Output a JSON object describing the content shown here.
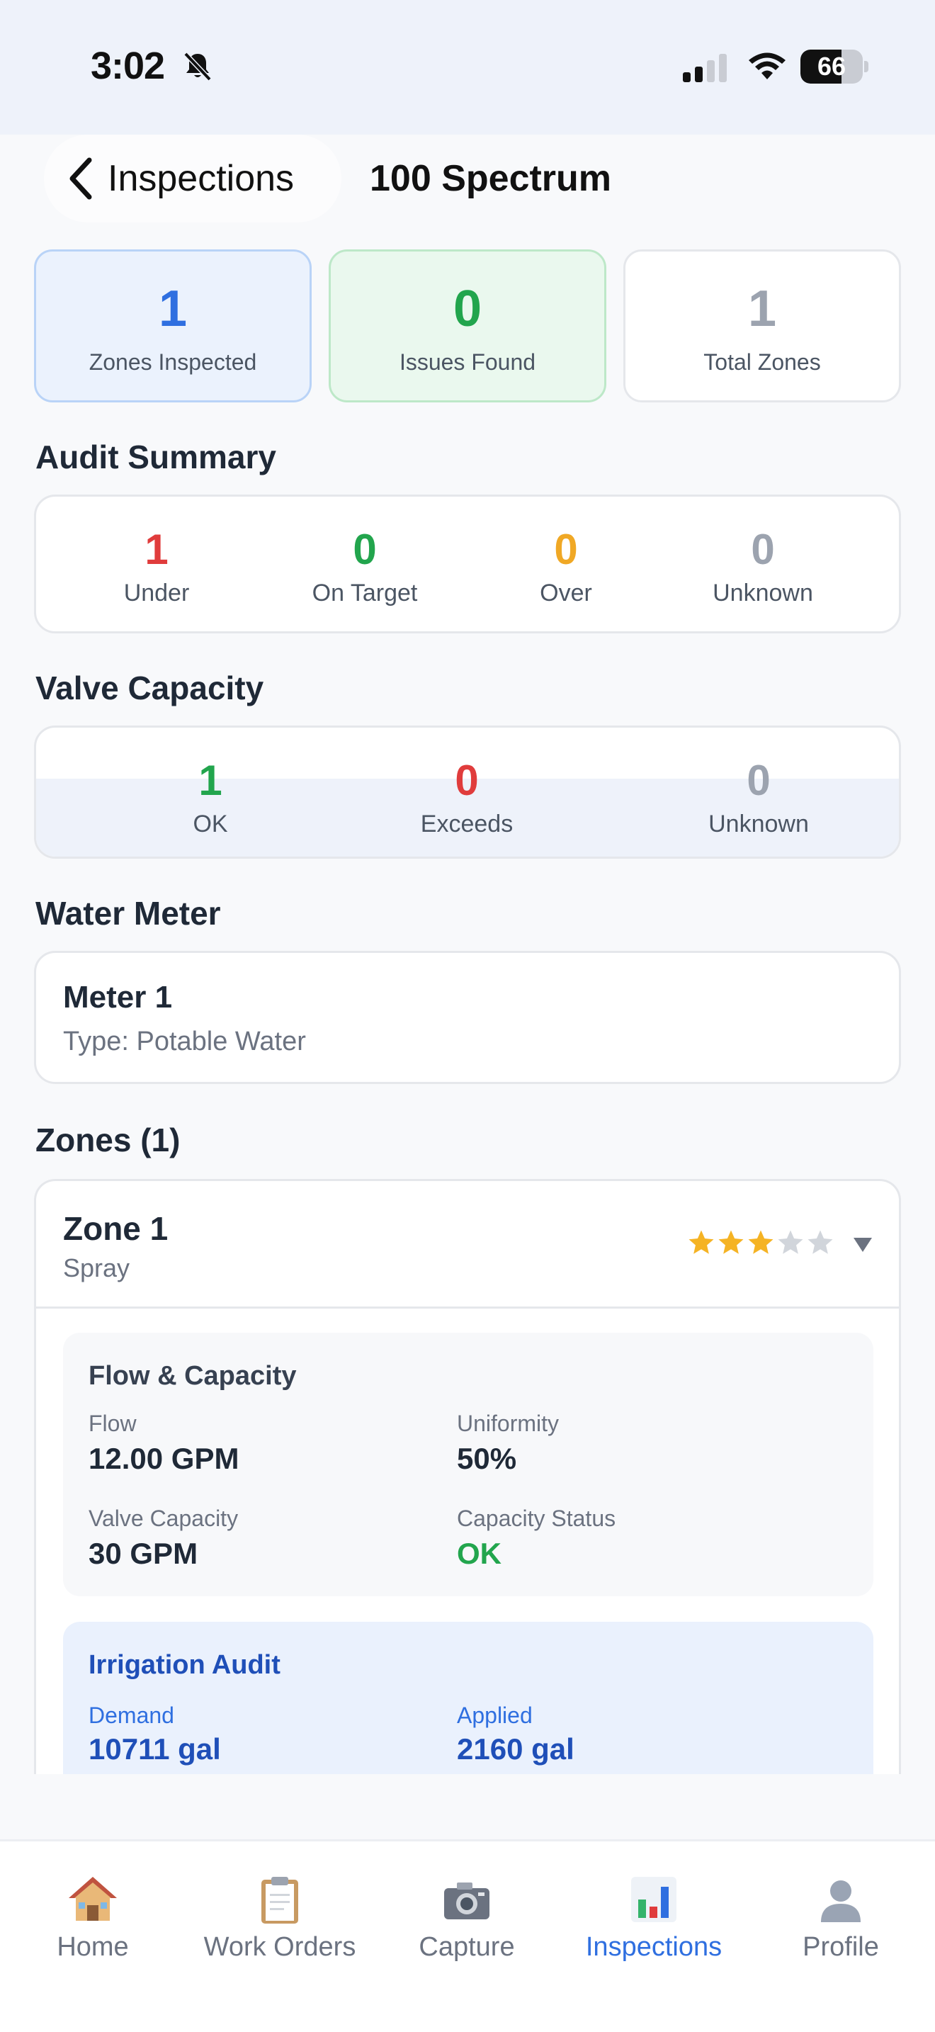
{
  "status_bar": {
    "time": "3:02",
    "battery": "66",
    "battery_level": 0.66
  },
  "header": {
    "back_label": "Inspections",
    "title": "100 Spectrum"
  },
  "summary_cards": [
    {
      "value": "1",
      "label": "Zones Inspected"
    },
    {
      "value": "0",
      "label": "Issues Found"
    },
    {
      "value": "1",
      "label": "Total Zones"
    }
  ],
  "audit_summary": {
    "title": "Audit Summary",
    "items": [
      {
        "value": "1",
        "label": "Under",
        "color": "#e03c3c"
      },
      {
        "value": "0",
        "label": "On Target",
        "color": "#22a54d"
      },
      {
        "value": "0",
        "label": "Over",
        "color": "#f0a825"
      },
      {
        "value": "0",
        "label": "Unknown",
        "color": "#9ca3af"
      }
    ]
  },
  "valve_capacity": {
    "title": "Valve Capacity",
    "items": [
      {
        "value": "1",
        "label": "OK",
        "color": "#22a54d"
      },
      {
        "value": "0",
        "label": "Exceeds",
        "color": "#e03c3c"
      },
      {
        "value": "0",
        "label": "Unknown",
        "color": "#9ca3af"
      }
    ]
  },
  "water_meter": {
    "title": "Water Meter",
    "name": "Meter 1",
    "type": "Type: Potable Water"
  },
  "zones": {
    "title": "Zones (1)",
    "items": [
      {
        "name": "Zone 1",
        "type": "Spray",
        "rating": 3,
        "rating_max": 5,
        "flow_capacity": {
          "title": "Flow & Capacity",
          "flow_label": "Flow",
          "flow_value": "12.00 GPM",
          "uniformity_label": "Uniformity",
          "uniformity_value": "50%",
          "valve_capacity_label": "Valve Capacity",
          "valve_capacity_value": "30 GPM",
          "capacity_status_label": "Capacity Status",
          "capacity_status_value": "OK"
        },
        "irrigation_audit": {
          "title": "Irrigation Audit",
          "demand_label": "Demand",
          "demand_value": "10711 gal",
          "applied_label": "Applied",
          "applied_value": "2160 gal"
        }
      }
    ]
  },
  "tab_bar": [
    {
      "label": "Home",
      "icon": "house-icon"
    },
    {
      "label": "Work Orders",
      "icon": "clipboard-icon"
    },
    {
      "label": "Capture",
      "icon": "camera-icon"
    },
    {
      "label": "Inspections",
      "icon": "bar-chart-icon",
      "active": true
    },
    {
      "label": "Profile",
      "icon": "person-icon"
    }
  ]
}
